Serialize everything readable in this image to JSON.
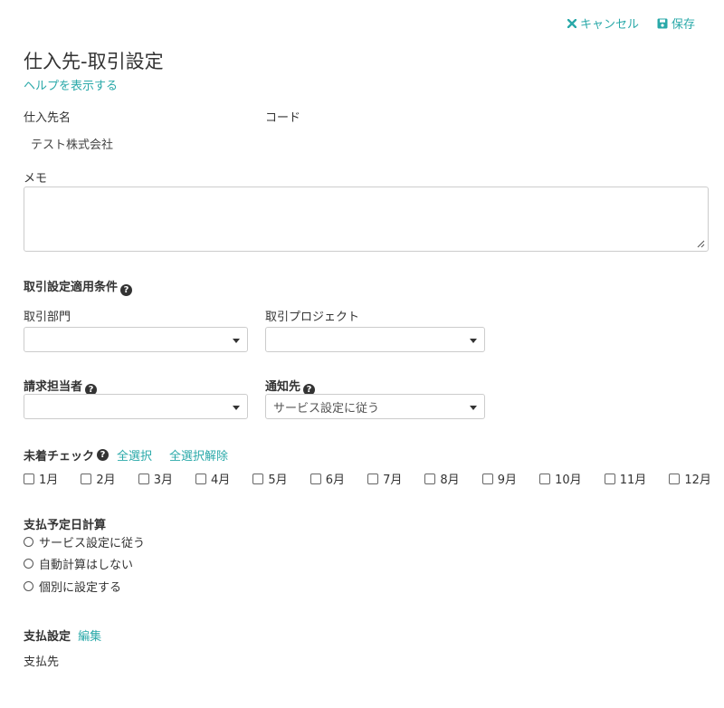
{
  "toolbar": {
    "cancel_label": "キャンセル",
    "save_label": "保存"
  },
  "page": {
    "title": "仕入先-取引設定",
    "help_link": "ヘルプを表示する"
  },
  "supplier": {
    "name_label": "仕入先名",
    "code_label": "コード",
    "name_value": "テスト株式会社"
  },
  "memo": {
    "label": "メモ",
    "value": ""
  },
  "conditions": {
    "heading": "取引設定適用条件",
    "department_label": "取引部門",
    "department_value": "",
    "project_label": "取引プロジェクト",
    "project_value": ""
  },
  "billing": {
    "person_label": "請求担当者",
    "person_value": "",
    "notify_label": "通知先",
    "notify_value": "サービス設定に従う"
  },
  "unarrived": {
    "label": "未着チェック",
    "select_all": "全選択",
    "deselect_all": "全選択解除",
    "months": [
      "1月",
      "2月",
      "3月",
      "4月",
      "5月",
      "6月",
      "7月",
      "8月",
      "9月",
      "10月",
      "11月",
      "12月"
    ]
  },
  "payment_date": {
    "label": "支払予定日計算",
    "options": [
      "サービス設定に従う",
      "自動計算はしない",
      "個別に設定する"
    ]
  },
  "payment_settings": {
    "label": "支払設定",
    "edit_link": "編集",
    "payee_label": "支払先"
  }
}
